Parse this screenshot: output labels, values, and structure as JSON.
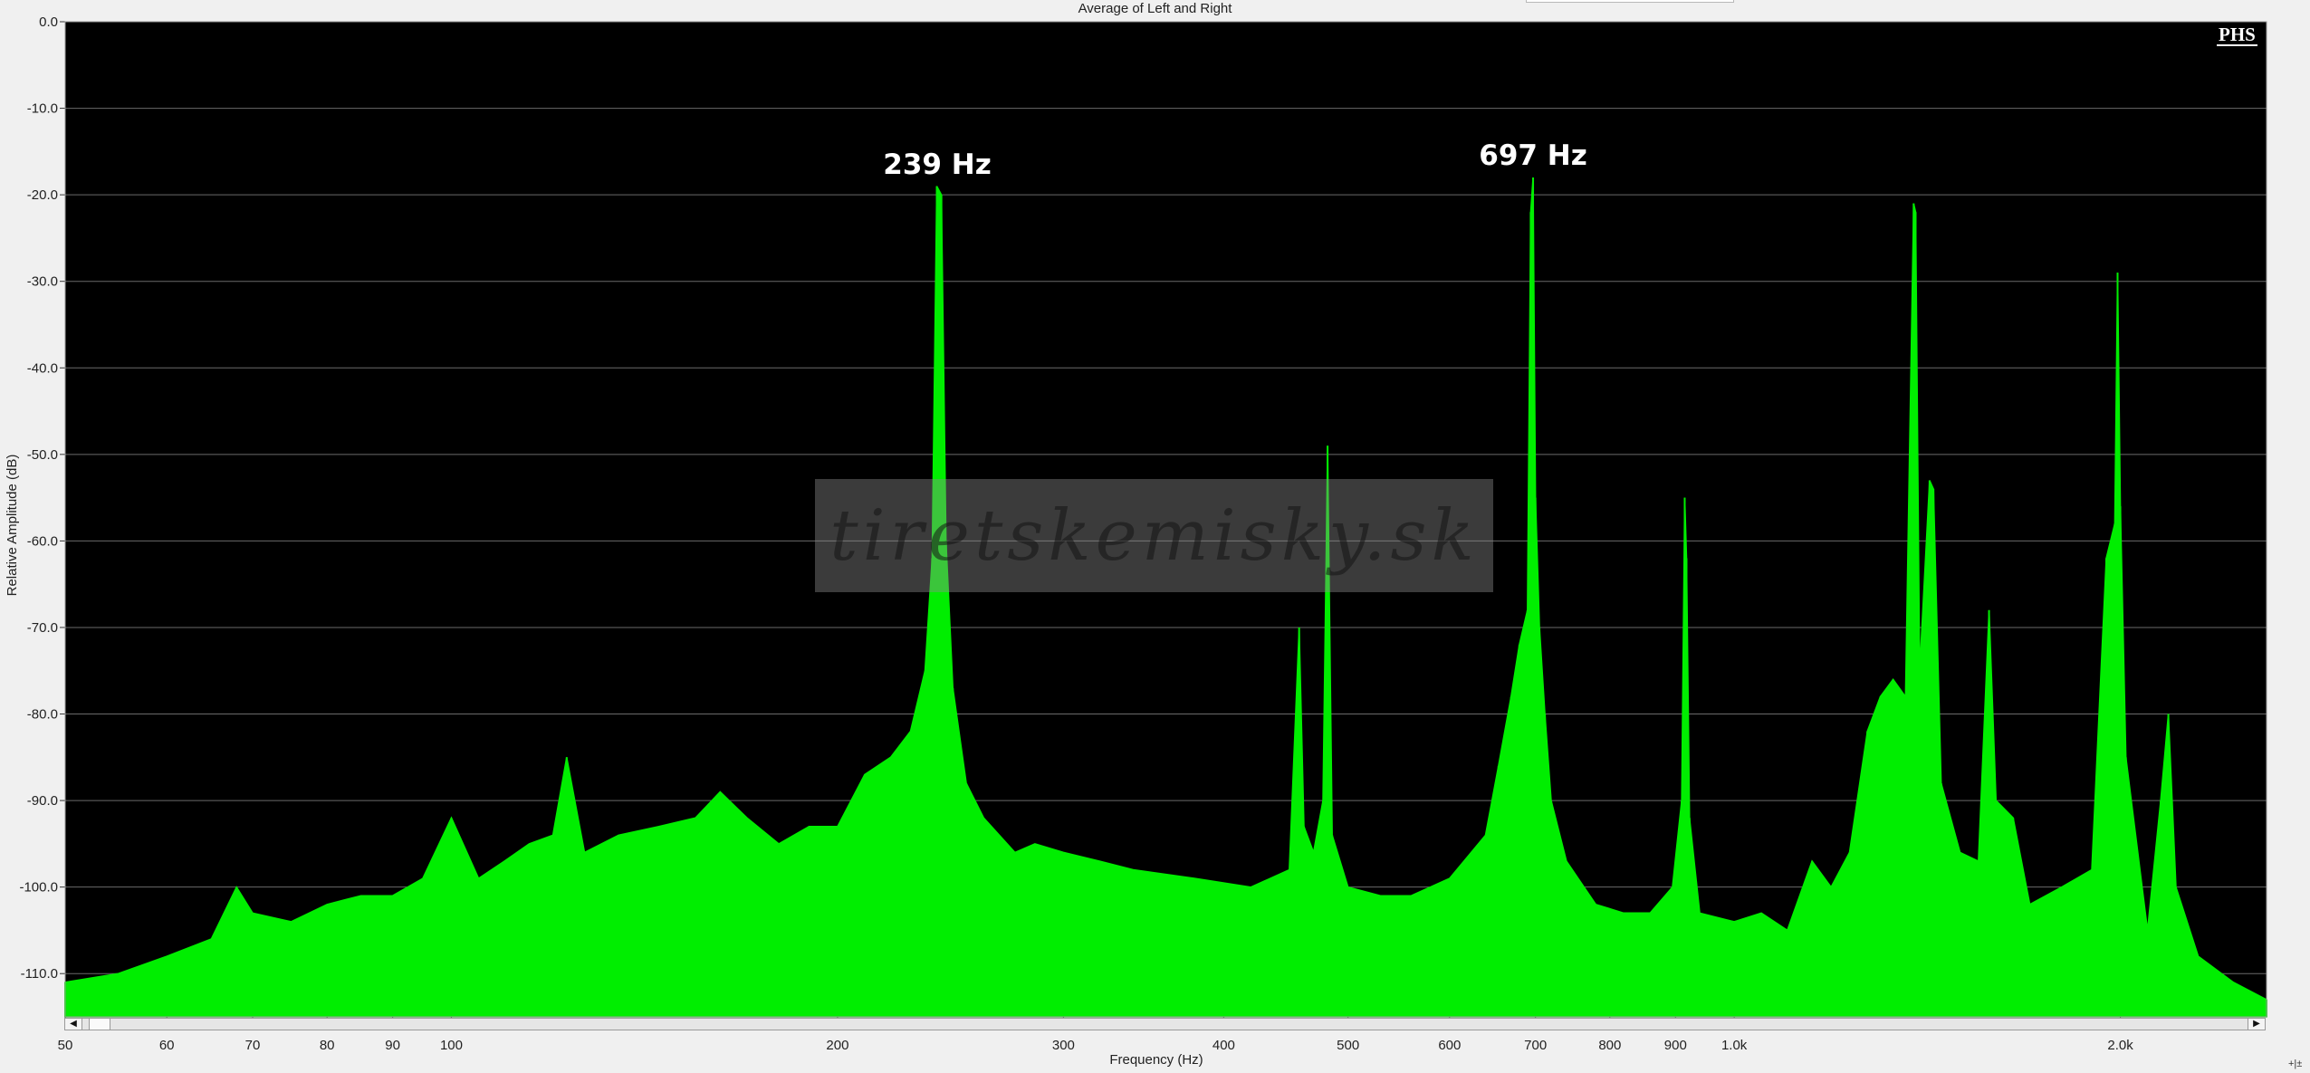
{
  "chart_data": {
    "type": "area",
    "title": "Average of Left and Right",
    "xlabel": "Frequency (Hz)",
    "ylabel": "Relative Amplitude (dB)",
    "x_scale": "log",
    "xlim": [
      50,
      2600
    ],
    "ylim": [
      -115,
      0
    ],
    "x_ticks": [
      {
        "value": 50,
        "label": "50"
      },
      {
        "value": 60,
        "label": "60"
      },
      {
        "value": 70,
        "label": "70"
      },
      {
        "value": 80,
        "label": "80"
      },
      {
        "value": 90,
        "label": "90"
      },
      {
        "value": 100,
        "label": "100"
      },
      {
        "value": 200,
        "label": "200"
      },
      {
        "value": 300,
        "label": "300"
      },
      {
        "value": 400,
        "label": "400"
      },
      {
        "value": 500,
        "label": "500"
      },
      {
        "value": 600,
        "label": "600"
      },
      {
        "value": 700,
        "label": "700"
      },
      {
        "value": 800,
        "label": "800"
      },
      {
        "value": 900,
        "label": "900"
      },
      {
        "value": 1000,
        "label": "1.0k"
      },
      {
        "value": 2000,
        "label": "2.0k"
      }
    ],
    "y_ticks": [
      {
        "value": 0,
        "label": "0.0"
      },
      {
        "value": -10,
        "label": "-10.0"
      },
      {
        "value": -20,
        "label": "-20.0"
      },
      {
        "value": -30,
        "label": "-30.0"
      },
      {
        "value": -40,
        "label": "-40.0"
      },
      {
        "value": -50,
        "label": "-50.0"
      },
      {
        "value": -60,
        "label": "-60.0"
      },
      {
        "value": -70,
        "label": "-70.0"
      },
      {
        "value": -80,
        "label": "-80.0"
      },
      {
        "value": -90,
        "label": "-90.0"
      },
      {
        "value": -100,
        "label": "-100.0"
      },
      {
        "value": -110,
        "label": "-110.0"
      }
    ],
    "grid": "horizontal",
    "background_color": "#000000",
    "series_color": "#00ee00",
    "series": [
      {
        "values_note_free": true,
        "points": [
          [
            50,
            -111
          ],
          [
            55,
            -110
          ],
          [
            60,
            -108
          ],
          [
            65,
            -106
          ],
          [
            68,
            -100
          ],
          [
            70,
            -103
          ],
          [
            75,
            -104
          ],
          [
            80,
            -102
          ],
          [
            85,
            -101
          ],
          [
            90,
            -101
          ],
          [
            95,
            -99
          ],
          [
            100,
            -92
          ],
          [
            105,
            -99
          ],
          [
            110,
            -97
          ],
          [
            115,
            -95
          ],
          [
            120,
            -94
          ],
          [
            123,
            -85
          ],
          [
            127,
            -96
          ],
          [
            135,
            -94
          ],
          [
            145,
            -93
          ],
          [
            155,
            -92
          ],
          [
            162,
            -89
          ],
          [
            170,
            -92
          ],
          [
            180,
            -95
          ],
          [
            190,
            -93
          ],
          [
            200,
            -93
          ],
          [
            210,
            -87
          ],
          [
            220,
            -85
          ],
          [
            228,
            -82
          ],
          [
            234,
            -75
          ],
          [
            237,
            -62
          ],
          [
            239,
            -19
          ],
          [
            241,
            -20
          ],
          [
            243,
            -60
          ],
          [
            246,
            -77
          ],
          [
            252,
            -88
          ],
          [
            260,
            -92
          ],
          [
            275,
            -96
          ],
          [
            285,
            -95
          ],
          [
            300,
            -96
          ],
          [
            320,
            -97
          ],
          [
            340,
            -98
          ],
          [
            380,
            -99
          ],
          [
            420,
            -100
          ],
          [
            450,
            -98
          ],
          [
            458,
            -70
          ],
          [
            462,
            -93
          ],
          [
            470,
            -96
          ],
          [
            478,
            -90
          ],
          [
            482,
            -49
          ],
          [
            486,
            -94
          ],
          [
            500,
            -100
          ],
          [
            530,
            -101
          ],
          [
            560,
            -101
          ],
          [
            600,
            -99
          ],
          [
            640,
            -94
          ],
          [
            655,
            -86
          ],
          [
            670,
            -78
          ],
          [
            680,
            -72
          ],
          [
            690,
            -68
          ],
          [
            694,
            -22
          ],
          [
            697,
            -18
          ],
          [
            700,
            -55
          ],
          [
            705,
            -70
          ],
          [
            712,
            -80
          ],
          [
            720,
            -90
          ],
          [
            740,
            -97
          ],
          [
            780,
            -102
          ],
          [
            820,
            -103
          ],
          [
            860,
            -103
          ],
          [
            895,
            -100
          ],
          [
            910,
            -90
          ],
          [
            915,
            -55
          ],
          [
            918,
            -62
          ],
          [
            923,
            -92
          ],
          [
            940,
            -103
          ],
          [
            1000,
            -104
          ],
          [
            1050,
            -103
          ],
          [
            1100,
            -105
          ],
          [
            1150,
            -97
          ],
          [
            1190,
            -100
          ],
          [
            1230,
            -96
          ],
          [
            1270,
            -82
          ],
          [
            1300,
            -78
          ],
          [
            1330,
            -76
          ],
          [
            1360,
            -78
          ],
          [
            1380,
            -21
          ],
          [
            1385,
            -22
          ],
          [
            1395,
            -75
          ],
          [
            1420,
            -53
          ],
          [
            1430,
            -54
          ],
          [
            1450,
            -88
          ],
          [
            1500,
            -96
          ],
          [
            1550,
            -97
          ],
          [
            1580,
            -68
          ],
          [
            1600,
            -90
          ],
          [
            1650,
            -92
          ],
          [
            1700,
            -102
          ],
          [
            1800,
            -100
          ],
          [
            1900,
            -98
          ],
          [
            1950,
            -62
          ],
          [
            1980,
            -58
          ],
          [
            1990,
            -29
          ],
          [
            2000,
            -56
          ],
          [
            2020,
            -85
          ],
          [
            2100,
            -105
          ],
          [
            2150,
            -90
          ],
          [
            2180,
            -80
          ],
          [
            2210,
            -100
          ],
          [
            2300,
            -108
          ],
          [
            2450,
            -111
          ],
          [
            2600,
            -113
          ]
        ]
      }
    ],
    "annotations": [
      {
        "text": "239 Hz",
        "x": 239
      },
      {
        "text": "697 Hz",
        "x": 697
      }
    ]
  },
  "watermark_text": "tiretskemisky.sk",
  "logo_text": "PHS",
  "corner_text": "+|±"
}
